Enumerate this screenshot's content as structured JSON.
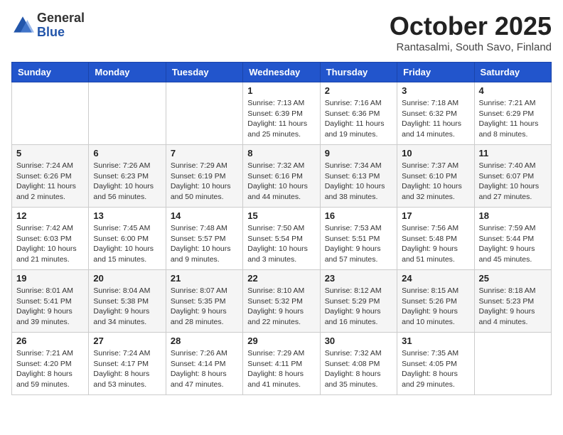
{
  "logo": {
    "general": "General",
    "blue": "Blue"
  },
  "title": "October 2025",
  "subtitle": "Rantasalmi, South Savo, Finland",
  "days_of_week": [
    "Sunday",
    "Monday",
    "Tuesday",
    "Wednesday",
    "Thursday",
    "Friday",
    "Saturday"
  ],
  "weeks": [
    [
      {
        "day": "",
        "info": ""
      },
      {
        "day": "",
        "info": ""
      },
      {
        "day": "",
        "info": ""
      },
      {
        "day": "1",
        "info": "Sunrise: 7:13 AM\nSunset: 6:39 PM\nDaylight: 11 hours\nand 25 minutes."
      },
      {
        "day": "2",
        "info": "Sunrise: 7:16 AM\nSunset: 6:36 PM\nDaylight: 11 hours\nand 19 minutes."
      },
      {
        "day": "3",
        "info": "Sunrise: 7:18 AM\nSunset: 6:32 PM\nDaylight: 11 hours\nand 14 minutes."
      },
      {
        "day": "4",
        "info": "Sunrise: 7:21 AM\nSunset: 6:29 PM\nDaylight: 11 hours\nand 8 minutes."
      }
    ],
    [
      {
        "day": "5",
        "info": "Sunrise: 7:24 AM\nSunset: 6:26 PM\nDaylight: 11 hours\nand 2 minutes."
      },
      {
        "day": "6",
        "info": "Sunrise: 7:26 AM\nSunset: 6:23 PM\nDaylight: 10 hours\nand 56 minutes."
      },
      {
        "day": "7",
        "info": "Sunrise: 7:29 AM\nSunset: 6:19 PM\nDaylight: 10 hours\nand 50 minutes."
      },
      {
        "day": "8",
        "info": "Sunrise: 7:32 AM\nSunset: 6:16 PM\nDaylight: 10 hours\nand 44 minutes."
      },
      {
        "day": "9",
        "info": "Sunrise: 7:34 AM\nSunset: 6:13 PM\nDaylight: 10 hours\nand 38 minutes."
      },
      {
        "day": "10",
        "info": "Sunrise: 7:37 AM\nSunset: 6:10 PM\nDaylight: 10 hours\nand 32 minutes."
      },
      {
        "day": "11",
        "info": "Sunrise: 7:40 AM\nSunset: 6:07 PM\nDaylight: 10 hours\nand 27 minutes."
      }
    ],
    [
      {
        "day": "12",
        "info": "Sunrise: 7:42 AM\nSunset: 6:03 PM\nDaylight: 10 hours\nand 21 minutes."
      },
      {
        "day": "13",
        "info": "Sunrise: 7:45 AM\nSunset: 6:00 PM\nDaylight: 10 hours\nand 15 minutes."
      },
      {
        "day": "14",
        "info": "Sunrise: 7:48 AM\nSunset: 5:57 PM\nDaylight: 10 hours\nand 9 minutes."
      },
      {
        "day": "15",
        "info": "Sunrise: 7:50 AM\nSunset: 5:54 PM\nDaylight: 10 hours\nand 3 minutes."
      },
      {
        "day": "16",
        "info": "Sunrise: 7:53 AM\nSunset: 5:51 PM\nDaylight: 9 hours\nand 57 minutes."
      },
      {
        "day": "17",
        "info": "Sunrise: 7:56 AM\nSunset: 5:48 PM\nDaylight: 9 hours\nand 51 minutes."
      },
      {
        "day": "18",
        "info": "Sunrise: 7:59 AM\nSunset: 5:44 PM\nDaylight: 9 hours\nand 45 minutes."
      }
    ],
    [
      {
        "day": "19",
        "info": "Sunrise: 8:01 AM\nSunset: 5:41 PM\nDaylight: 9 hours\nand 39 minutes."
      },
      {
        "day": "20",
        "info": "Sunrise: 8:04 AM\nSunset: 5:38 PM\nDaylight: 9 hours\nand 34 minutes."
      },
      {
        "day": "21",
        "info": "Sunrise: 8:07 AM\nSunset: 5:35 PM\nDaylight: 9 hours\nand 28 minutes."
      },
      {
        "day": "22",
        "info": "Sunrise: 8:10 AM\nSunset: 5:32 PM\nDaylight: 9 hours\nand 22 minutes."
      },
      {
        "day": "23",
        "info": "Sunrise: 8:12 AM\nSunset: 5:29 PM\nDaylight: 9 hours\nand 16 minutes."
      },
      {
        "day": "24",
        "info": "Sunrise: 8:15 AM\nSunset: 5:26 PM\nDaylight: 9 hours\nand 10 minutes."
      },
      {
        "day": "25",
        "info": "Sunrise: 8:18 AM\nSunset: 5:23 PM\nDaylight: 9 hours\nand 4 minutes."
      }
    ],
    [
      {
        "day": "26",
        "info": "Sunrise: 7:21 AM\nSunset: 4:20 PM\nDaylight: 8 hours\nand 59 minutes."
      },
      {
        "day": "27",
        "info": "Sunrise: 7:24 AM\nSunset: 4:17 PM\nDaylight: 8 hours\nand 53 minutes."
      },
      {
        "day": "28",
        "info": "Sunrise: 7:26 AM\nSunset: 4:14 PM\nDaylight: 8 hours\nand 47 minutes."
      },
      {
        "day": "29",
        "info": "Sunrise: 7:29 AM\nSunset: 4:11 PM\nDaylight: 8 hours\nand 41 minutes."
      },
      {
        "day": "30",
        "info": "Sunrise: 7:32 AM\nSunset: 4:08 PM\nDaylight: 8 hours\nand 35 minutes."
      },
      {
        "day": "31",
        "info": "Sunrise: 7:35 AM\nSunset: 4:05 PM\nDaylight: 8 hours\nand 29 minutes."
      },
      {
        "day": "",
        "info": ""
      }
    ]
  ]
}
